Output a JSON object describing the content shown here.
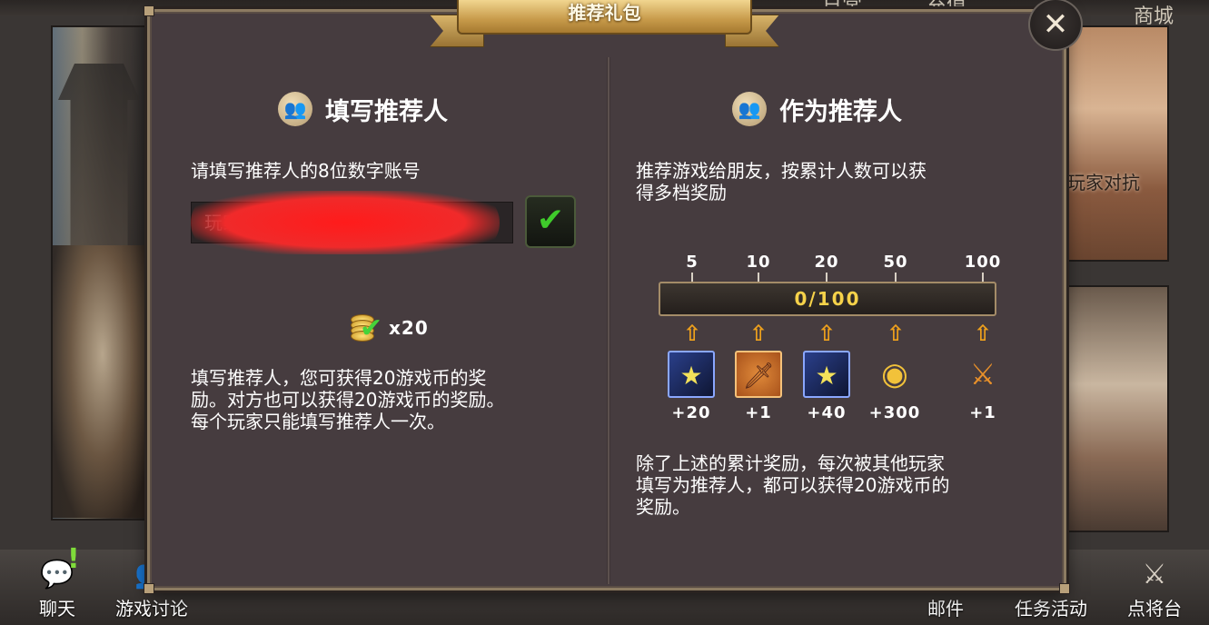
{
  "background": {
    "top_labels": [
      "日常",
      "充值",
      "商城"
    ],
    "art_label": "玩家对抗",
    "bottom_nav": [
      {
        "label": "聊天",
        "icon": "chat-icon",
        "alert": "!"
      },
      {
        "label": "游戏讨论",
        "icon": "forum-icon"
      },
      {
        "label": "邮件",
        "icon": "mail-icon"
      },
      {
        "label": "任务活动",
        "icon": "quest-icon"
      },
      {
        "label": "点将台",
        "icon": "general-icon"
      }
    ]
  },
  "dialog": {
    "title": "推荐礼包",
    "close_icon": "close-icon",
    "left": {
      "header": "填写推荐人",
      "instruction": "请填写推荐人的8位数字账号",
      "input_placeholder": "玩家通过推荐人推荐了游戏",
      "reward_count": "x20",
      "description_lines": [
        "填写推荐人，您可获得20游戏币的奖",
        "励。对方也可以获得20游戏币的奖励。",
        "每个玩家只能填写推荐人一次。"
      ]
    },
    "right": {
      "header": "作为推荐人",
      "intro_lines": [
        "推荐游戏给朋友，按累计人数可以获",
        "得多档奖励"
      ],
      "progress": {
        "current": 0,
        "max": 100,
        "text": "0/100"
      },
      "milestones": [
        {
          "threshold": "5",
          "reward_icon": "hero-card-icon",
          "amount": "+20"
        },
        {
          "threshold": "10",
          "reward_icon": "weapon-icon",
          "amount": "+1"
        },
        {
          "threshold": "20",
          "reward_icon": "hero-card-icon",
          "amount": "+40"
        },
        {
          "threshold": "50",
          "reward_icon": "coin-stack-icon",
          "amount": "+300"
        },
        {
          "threshold": "100",
          "reward_icon": "fire-sword-icon",
          "amount": "+1"
        }
      ],
      "footer_lines": [
        "除了上述的累计奖励，每次被其他玩家",
        "填写为推荐人，都可以获得20游戏币的",
        "奖励。"
      ]
    }
  },
  "colors": {
    "panel": "#463c3f",
    "ribbon_gold": "#c79a4a",
    "progress_text": "#f6d24a",
    "arrow": "#f0a21c",
    "confirm_check": "#3fcb2b"
  }
}
